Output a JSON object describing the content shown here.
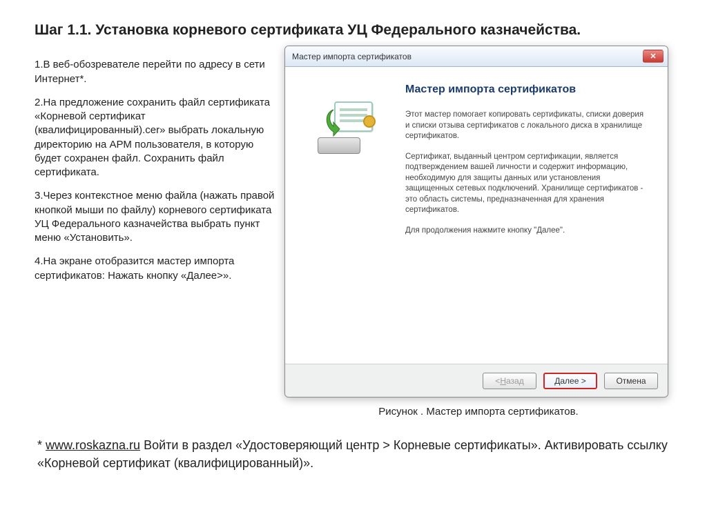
{
  "page": {
    "heading": "Шаг 1.1. Установка корневого сертификата УЦ Федерального казначейства."
  },
  "steps": {
    "s1": "1.В веб-обозревателе перейти по адресу в сети Интернет*.",
    "s2": "2.На предложение сохранить файл сертификата «Корневой сертификат (квалифицированный).cer» выбрать локальную директорию на АРМ пользователя, в которую будет сохранен файл. Сохранить файл сертификата.",
    "s3": "3.Через контекстное меню файла (нажать правой кнопкой мыши по файлу) корневого сертификата УЦ Федерального казначейства выбрать пункт меню «Установить».",
    "s4": "4.На экране отобразится мастер импорта сертификатов: Нажать кнопку «Далее>»."
  },
  "window": {
    "title": "Мастер импорта сертификатов",
    "wiz_heading": "Мастер импорта сертификатов",
    "p1": "Этот мастер помогает копировать сертификаты, списки доверия и списки отзыва сертификатов с локального диска в хранилище сертификатов.",
    "p2": "Сертификат, выданный центром сертификации, является подтверждением вашей личности и содержит информацию, необходимую для защиты данных или установления защищенных сетевых подключений. Хранилище сертификатов - это область системы, предназначенная для хранения сертификатов.",
    "p3": "Для продолжения нажмите кнопку \"Далее\".",
    "buttons": {
      "back_prefix": "< ",
      "back_u": "Н",
      "back_rest": "азад",
      "next_u": "Д",
      "next_rest": "алее >",
      "cancel": "Отмена"
    }
  },
  "caption": "Рисунок . Мастер импорта сертификатов.",
  "footnote": {
    "prefix": "* ",
    "link": "www.roskazna.ru",
    "rest": "  Войти в раздел «Удостоверяющий центр > Корневые сертификаты». Активировать ссылку «Корневой сертификат (квалифицированный)»."
  }
}
